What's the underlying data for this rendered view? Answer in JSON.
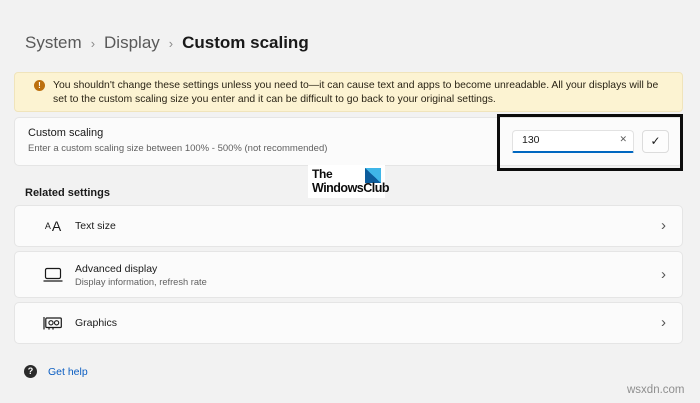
{
  "breadcrumb": {
    "root": "System",
    "section": "Display",
    "current": "Custom scaling"
  },
  "warning": {
    "text": "You shouldn't change these settings unless you need to—it can cause text and apps to become unreadable. All your displays will be set to the custom scaling size you enter and it can be difficult to go back to your original settings."
  },
  "custom_scaling": {
    "title": "Custom scaling",
    "description": "Enter a custom scaling size between 100% - 500% (not recommended)",
    "value": "130"
  },
  "logo": {
    "line1": "The",
    "line2": "WindowsClub"
  },
  "related": {
    "header": "Related settings",
    "items": [
      {
        "label": "Text size",
        "description": ""
      },
      {
        "label": "Advanced display",
        "description": "Display information, refresh rate"
      },
      {
        "label": "Graphics",
        "description": ""
      }
    ]
  },
  "footer": {
    "get_help": "Get help"
  },
  "watermark": "wsxdn.com",
  "icons": {
    "separator": "›",
    "chevron": "›",
    "warning": "!",
    "clear": "✕",
    "confirm": "✓",
    "help": "?",
    "text_size_small": "A",
    "text_size_large": "A"
  },
  "colors": {
    "accent": "#0067c0",
    "warning_bg": "#fcf3d2",
    "warning_icon": "#bc6f0d",
    "link": "#0a5dc2"
  }
}
